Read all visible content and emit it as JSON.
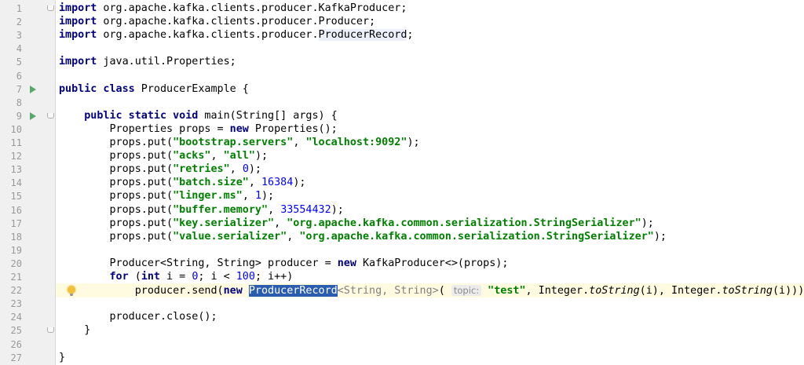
{
  "editor": {
    "lines": [
      {
        "n": "1",
        "tokens": [
          {
            "t": "kw",
            "v": "import"
          },
          {
            "t": "",
            "v": " org.apache.kafka.clients.producer.KafkaProducer;"
          }
        ]
      },
      {
        "n": "2",
        "tokens": [
          {
            "t": "kw",
            "v": "import"
          },
          {
            "t": "",
            "v": " org.apache.kafka.clients.producer.Producer;"
          }
        ]
      },
      {
        "n": "3",
        "tokens": [
          {
            "t": "kw",
            "v": "import"
          },
          {
            "t": "",
            "v": " org.apache.kafka.clients.producer."
          },
          {
            "t": "hl",
            "v": "ProducerRecord"
          },
          {
            "t": "",
            "v": ";"
          }
        ]
      },
      {
        "n": "4",
        "tokens": []
      },
      {
        "n": "5",
        "tokens": [
          {
            "t": "kw",
            "v": "import"
          },
          {
            "t": "",
            "v": " java.util.Properties;"
          }
        ]
      },
      {
        "n": "6",
        "tokens": []
      },
      {
        "n": "7",
        "tokens": [
          {
            "t": "kw",
            "v": "public class"
          },
          {
            "t": "",
            "v": " ProducerExample {"
          }
        ]
      },
      {
        "n": "8",
        "tokens": []
      },
      {
        "n": "9",
        "tokens": [
          {
            "t": "",
            "v": "    "
          },
          {
            "t": "kw",
            "v": "public static void"
          },
          {
            "t": "",
            "v": " main(String[] args) {"
          }
        ]
      },
      {
        "n": "10",
        "tokens": [
          {
            "t": "",
            "v": "        Properties props = "
          },
          {
            "t": "kw",
            "v": "new"
          },
          {
            "t": "",
            "v": " Properties();"
          }
        ]
      },
      {
        "n": "11",
        "tokens": [
          {
            "t": "",
            "v": "        props.put("
          },
          {
            "t": "str",
            "v": "\"bootstrap.servers\""
          },
          {
            "t": "",
            "v": ", "
          },
          {
            "t": "str",
            "v": "\"localhost:9092\""
          },
          {
            "t": "",
            "v": ");"
          }
        ]
      },
      {
        "n": "12",
        "tokens": [
          {
            "t": "",
            "v": "        props.put("
          },
          {
            "t": "str",
            "v": "\"acks\""
          },
          {
            "t": "",
            "v": ", "
          },
          {
            "t": "str",
            "v": "\"all\""
          },
          {
            "t": "",
            "v": ");"
          }
        ]
      },
      {
        "n": "13",
        "tokens": [
          {
            "t": "",
            "v": "        props.put("
          },
          {
            "t": "str",
            "v": "\"retries\""
          },
          {
            "t": "",
            "v": ", "
          },
          {
            "t": "num",
            "v": "0"
          },
          {
            "t": "",
            "v": ");"
          }
        ]
      },
      {
        "n": "14",
        "tokens": [
          {
            "t": "",
            "v": "        props.put("
          },
          {
            "t": "str",
            "v": "\"batch.size\""
          },
          {
            "t": "",
            "v": ", "
          },
          {
            "t": "num",
            "v": "16384"
          },
          {
            "t": "",
            "v": ");"
          }
        ]
      },
      {
        "n": "15",
        "tokens": [
          {
            "t": "",
            "v": "        props.put("
          },
          {
            "t": "str",
            "v": "\"linger.ms\""
          },
          {
            "t": "",
            "v": ", "
          },
          {
            "t": "num",
            "v": "1"
          },
          {
            "t": "",
            "v": ");"
          }
        ]
      },
      {
        "n": "16",
        "tokens": [
          {
            "t": "",
            "v": "        props.put("
          },
          {
            "t": "str",
            "v": "\"buffer.memory\""
          },
          {
            "t": "",
            "v": ", "
          },
          {
            "t": "num",
            "v": "33554432"
          },
          {
            "t": "",
            "v": ");"
          }
        ]
      },
      {
        "n": "17",
        "tokens": [
          {
            "t": "",
            "v": "        props.put("
          },
          {
            "t": "str",
            "v": "\"key.serializer\""
          },
          {
            "t": "",
            "v": ", "
          },
          {
            "t": "str",
            "v": "\"org.apache.kafka.common.serialization.StringSerializer\""
          },
          {
            "t": "",
            "v": ");"
          }
        ]
      },
      {
        "n": "18",
        "tokens": [
          {
            "t": "",
            "v": "        props.put("
          },
          {
            "t": "str",
            "v": "\"value.serializer\""
          },
          {
            "t": "",
            "v": ", "
          },
          {
            "t": "str",
            "v": "\"org.apache.kafka.common.serialization.StringSerializer\""
          },
          {
            "t": "",
            "v": ");"
          }
        ]
      },
      {
        "n": "19",
        "tokens": []
      },
      {
        "n": "20",
        "tokens": [
          {
            "t": "",
            "v": "        Producer<String, String> producer = "
          },
          {
            "t": "kw",
            "v": "new"
          },
          {
            "t": "",
            "v": " KafkaProducer<>(props);"
          }
        ]
      },
      {
        "n": "21",
        "tokens": [
          {
            "t": "",
            "v": "        "
          },
          {
            "t": "kw",
            "v": "for"
          },
          {
            "t": "",
            "v": " ("
          },
          {
            "t": "kw",
            "v": "int"
          },
          {
            "t": "",
            "v": " i = "
          },
          {
            "t": "num",
            "v": "0"
          },
          {
            "t": "",
            "v": "; i < "
          },
          {
            "t": "num",
            "v": "100"
          },
          {
            "t": "",
            "v": "; i++)"
          }
        ]
      },
      {
        "n": "22",
        "tokens": [
          {
            "t": "",
            "v": "            producer.send("
          },
          {
            "t": "kw",
            "v": "new"
          },
          {
            "t": "",
            "v": " "
          },
          {
            "t": "sel",
            "v": "ProducerRecord"
          },
          {
            "t": "gray",
            "v": "<String, String>"
          },
          {
            "t": "",
            "v": "( "
          },
          {
            "t": "hint",
            "v": "topic:"
          },
          {
            "t": "",
            "v": " "
          },
          {
            "t": "str",
            "v": "\"test\""
          },
          {
            "t": "",
            "v": ", Integer."
          },
          {
            "t": "it",
            "v": "toString"
          },
          {
            "t": "",
            "v": "(i), Integer."
          },
          {
            "t": "it",
            "v": "toString"
          },
          {
            "t": "",
            "v": "(i)));"
          }
        ]
      },
      {
        "n": "23",
        "tokens": []
      },
      {
        "n": "24",
        "tokens": [
          {
            "t": "",
            "v": "        producer.close();"
          }
        ]
      },
      {
        "n": "25",
        "tokens": [
          {
            "t": "",
            "v": "    }"
          }
        ]
      },
      {
        "n": "26",
        "tokens": []
      },
      {
        "n": "27",
        "tokens": [
          {
            "t": "",
            "v": "}"
          }
        ]
      }
    ],
    "run_lines": [
      "7",
      "9"
    ],
    "fold_lines": [
      "1",
      "9",
      "25"
    ],
    "bulb_line": "22",
    "active_line": "22",
    "colors": {
      "keyword": "#000080",
      "string": "#008000",
      "number": "#0000ff",
      "selection": "#2a5db0",
      "active_line": "#fffbe0"
    }
  }
}
